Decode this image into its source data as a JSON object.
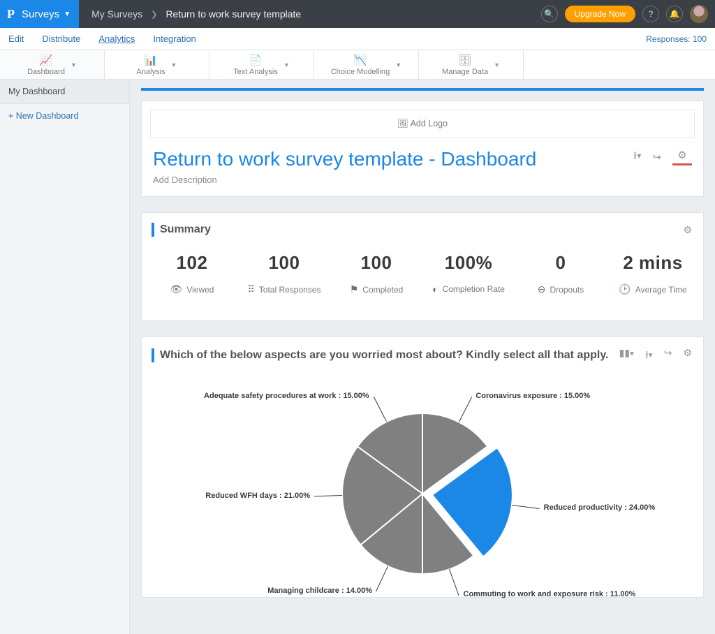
{
  "header": {
    "brand": "Surveys",
    "breadcrumb_root": "My Surveys",
    "breadcrumb_title": "Return to work survey template",
    "upgrade_label": "Upgrade Now"
  },
  "subnav": {
    "items": [
      "Edit",
      "Distribute",
      "Analytics",
      "Integration"
    ],
    "active_index": 2,
    "responses_label": "Responses: 100"
  },
  "toolbar": {
    "tabs": [
      "Dashboard",
      "Analysis",
      "Text Analysis",
      "Choice Modelling",
      "Manage Data"
    ],
    "active_index": 0
  },
  "sidebar": {
    "current": "My Dashboard",
    "add_label": "+  New Dashboard"
  },
  "dashboard_header": {
    "add_logo": "Add Logo",
    "title": "Return to work survey template - Dashboard",
    "description": "Add Description"
  },
  "summary": {
    "heading": "Summary",
    "stats": [
      {
        "value": "102",
        "label": "Viewed",
        "icon": "eye"
      },
      {
        "value": "100",
        "label": "Total Responses",
        "icon": "grid"
      },
      {
        "value": "100",
        "label": "Completed",
        "icon": "flag"
      },
      {
        "value": "100%",
        "label": "Completion Rate",
        "icon": "half"
      },
      {
        "value": "0",
        "label": "Dropouts",
        "icon": "minus"
      },
      {
        "value": "2 mins",
        "label": "Average Time",
        "icon": "clock"
      }
    ]
  },
  "question": {
    "heading": "Which of the below aspects are you worried most about? Kindly select all that apply."
  },
  "chart_data": {
    "type": "pie",
    "title": "",
    "unit": "percent",
    "series": [
      {
        "name": "Coronavirus exposure",
        "value": 15.0,
        "color": "#808080"
      },
      {
        "name": "Reduced productivity",
        "value": 24.0,
        "color": "#1b87e6"
      },
      {
        "name": "Commuting to work and exposure risk",
        "value": 11.0,
        "color": "#808080"
      },
      {
        "name": "Managing childcare",
        "value": 14.0,
        "color": "#808080"
      },
      {
        "name": "Reduced WFH days",
        "value": 21.0,
        "color": "#808080"
      },
      {
        "name": "Adequate safety procedures at work",
        "value": 15.0,
        "color": "#808080"
      }
    ],
    "highlight_index": 1,
    "label_format": "{name} : {value}%"
  }
}
